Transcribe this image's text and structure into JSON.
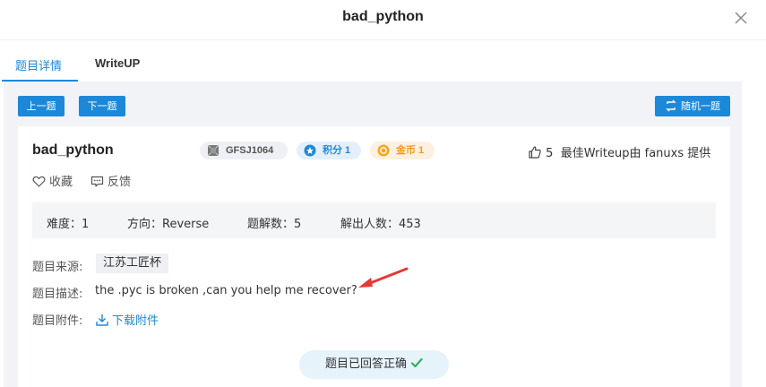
{
  "dialog": {
    "title": "bad_python"
  },
  "tabs": [
    {
      "label": "题目详情",
      "active": true
    },
    {
      "label": "WriteUP",
      "active": false
    }
  ],
  "nav": {
    "prev_label": "上一题",
    "next_label": "下一题",
    "random_label": "随机一题"
  },
  "challenge": {
    "name": "bad_python",
    "tags": {
      "id": "GFSJ1064",
      "score": "积分 1",
      "coins": "金币 1"
    },
    "likes_count": "5",
    "best_writeup": "最佳Writeup由 fanuxs 提供",
    "favorite_label": "收藏",
    "feedback_label": "反馈",
    "stats": {
      "difficulty": "难度：1",
      "direction": "方向：Reverse",
      "solution_count": "题解数：5",
      "solver_count": "解出人数：453"
    },
    "source_label": "题目来源:",
    "source_value": "江苏工匠杯",
    "description_label": "题目描述:",
    "description_value": "the .pyc is broken ,can you help me recover?",
    "attachment_label": "题目附件:",
    "attachment_link": "下载附件",
    "solved_status": "题目已回答正确"
  },
  "colors": {
    "accent": "#1e88d8",
    "score_bg": "#e3f0fc",
    "coin": "#f39a1a",
    "success": "#2fb35a",
    "arrow": "#e53935"
  }
}
